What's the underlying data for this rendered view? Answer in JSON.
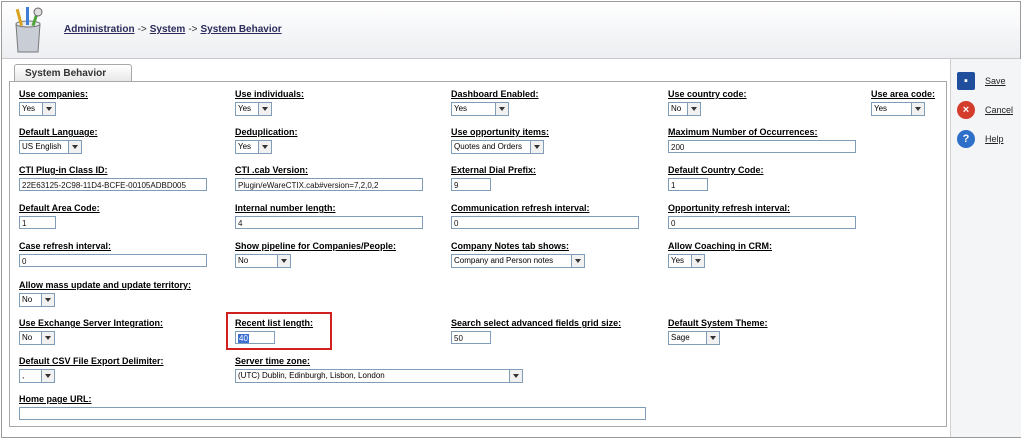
{
  "breadcrumb": {
    "items": [
      "Administration",
      "System",
      "System Behavior"
    ],
    "separator": "->"
  },
  "tab": {
    "label": "System Behavior"
  },
  "actions": {
    "save": "Save",
    "cancel": "Cancel",
    "help": "Help"
  },
  "fields": {
    "use_companies": {
      "label": "Use companies:",
      "value": "Yes"
    },
    "use_individuals": {
      "label": "Use individuals:",
      "value": "Yes"
    },
    "dashboard_enabled": {
      "label": "Dashboard Enabled:",
      "value": "Yes"
    },
    "use_country_code": {
      "label": "Use country code:",
      "value": "No"
    },
    "use_area_code": {
      "label": "Use area code:",
      "value": "Yes"
    },
    "default_language": {
      "label": "Default Language:",
      "value": "US English"
    },
    "deduplication": {
      "label": "Deduplication:",
      "value": "Yes"
    },
    "use_opportunity_items": {
      "label": "Use opportunity items:",
      "value": "Quotes and Orders"
    },
    "max_occurrences": {
      "label": "Maximum Number of Occurrences:",
      "value": "200"
    },
    "cti_plugin_class_id": {
      "label": "CTI Plug-in Class ID:",
      "value": "22E63125-2C98-11D4-BCFE-00105ADBD005"
    },
    "cti_cab_version": {
      "label": "CTI .cab Version:",
      "value": "Plugin/eWareCTIX.cab#version=7,2,0,2"
    },
    "external_dial_prefix": {
      "label": "External Dial Prefix:",
      "value": "9"
    },
    "default_country_code": {
      "label": "Default Country Code:",
      "value": "1"
    },
    "default_area_code": {
      "label": "Default Area Code:",
      "value": "1"
    },
    "internal_number_length": {
      "label": "Internal number length:",
      "value": "4"
    },
    "communication_refresh": {
      "label": "Communication refresh interval:",
      "value": "0"
    },
    "opportunity_refresh": {
      "label": "Opportunity refresh interval:",
      "value": "0"
    },
    "case_refresh": {
      "label": "Case refresh interval:",
      "value": "0"
    },
    "show_pipeline": {
      "label": "Show pipeline for Companies/People:",
      "value": "No"
    },
    "company_notes_tab": {
      "label": "Company Notes tab shows:",
      "value": "Company and Person notes"
    },
    "allow_coaching": {
      "label": "Allow Coaching in CRM:",
      "value": "Yes"
    },
    "allow_mass_update": {
      "label": "Allow mass update and update territory:",
      "value": "No"
    },
    "use_exchange": {
      "label": "Use Exchange Server Integration:",
      "value": "No"
    },
    "recent_list_length": {
      "label": "Recent list length:",
      "value": "40"
    },
    "search_grid_size": {
      "label": "Search select advanced fields grid size:",
      "value": "50"
    },
    "default_theme": {
      "label": "Default System Theme:",
      "value": "Sage"
    },
    "csv_delimiter": {
      "label": "Default CSV File Export Delimiter:",
      "value": ","
    },
    "server_time_zone": {
      "label": "Server time zone:",
      "value": "(UTC) Dublin, Edinburgh, Lisbon, London"
    },
    "home_page_url": {
      "label": "Home page URL:",
      "value": ""
    }
  },
  "colors": {
    "highlight": "#d02020",
    "save_icon": "#1f4e9c",
    "cancel_icon": "#d43c2c",
    "help_icon": "#2e6fc9"
  }
}
